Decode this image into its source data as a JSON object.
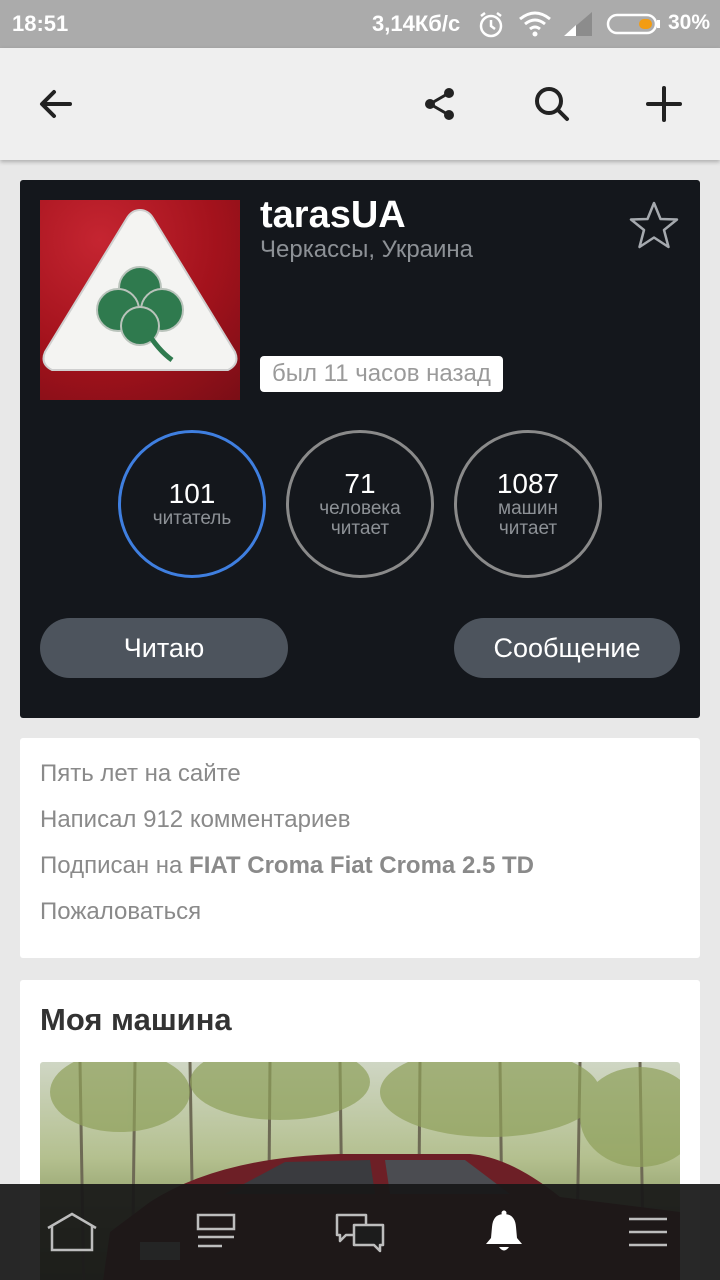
{
  "status_bar": {
    "time": "18:51",
    "network_speed": "3,14Кб/с",
    "battery_percent": "30%",
    "battery_level": 0.3,
    "icons": [
      "alarm-icon",
      "wifi-icon",
      "signal-icon",
      "battery-icon"
    ]
  },
  "app_bar": {
    "icons": [
      "back-arrow-icon",
      "share-icon",
      "search-icon",
      "plus-icon"
    ]
  },
  "profile": {
    "username": "tarasUA",
    "location": "Черкассы, Украина",
    "last_seen": "был 11 часов назад",
    "stats": [
      {
        "value": "101",
        "label": "читатель",
        "label2": ""
      },
      {
        "value": "71",
        "label": "человека",
        "label2": "читает"
      },
      {
        "value": "1087",
        "label": "машин",
        "label2": "читает"
      }
    ],
    "follow_button": "Читаю",
    "message_button": "Сообщение"
  },
  "info": {
    "years": "Пять лет на сайте",
    "comments": "Написал 912 комментариев",
    "subscribed_prefix": "Подписан на",
    "subscribed_car": "FIAT Croma Fiat Croma 2.5 TD",
    "report": "Пожаловаться"
  },
  "my_car": {
    "heading": "Моя машина"
  },
  "bottom_nav": {
    "items": [
      "home-icon",
      "feed-icon",
      "messages-icon",
      "notifications-icon",
      "menu-icon"
    ],
    "active": "notifications-icon"
  },
  "colors": {
    "accent": "#3f7fe0",
    "card_dark": "#14171c",
    "button": "#4d545d"
  }
}
